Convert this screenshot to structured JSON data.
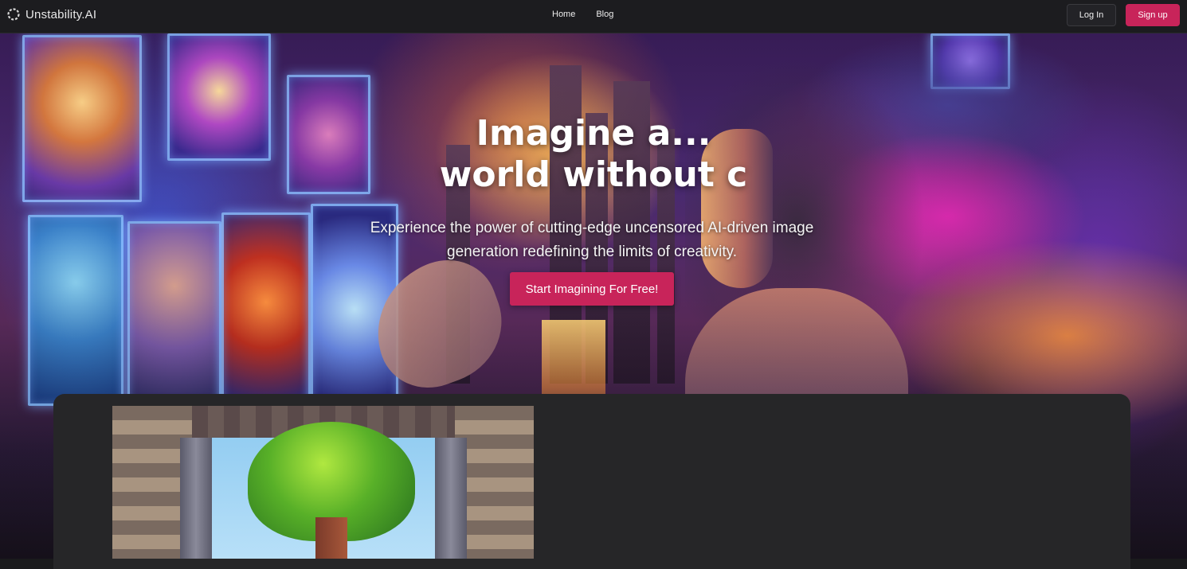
{
  "brand": {
    "name": "Unstability.AI",
    "logo_icon": "spinner-logo-icon"
  },
  "nav": {
    "items": [
      {
        "label": "Home"
      },
      {
        "label": "Blog"
      }
    ]
  },
  "auth": {
    "login_label": "Log In",
    "signup_label": "Sign up"
  },
  "hero": {
    "title_line1": "Imagine a...",
    "title_line2": "world without c",
    "subtitle": "Experience the power of cutting-edge uncensored AI-driven image generation redefining the limits of creativity.",
    "cta_label": "Start Imagining For Free!"
  },
  "colors": {
    "accent": "#c8245a",
    "navbar_bg": "#1c1c1f",
    "card_bg": "#262628"
  }
}
